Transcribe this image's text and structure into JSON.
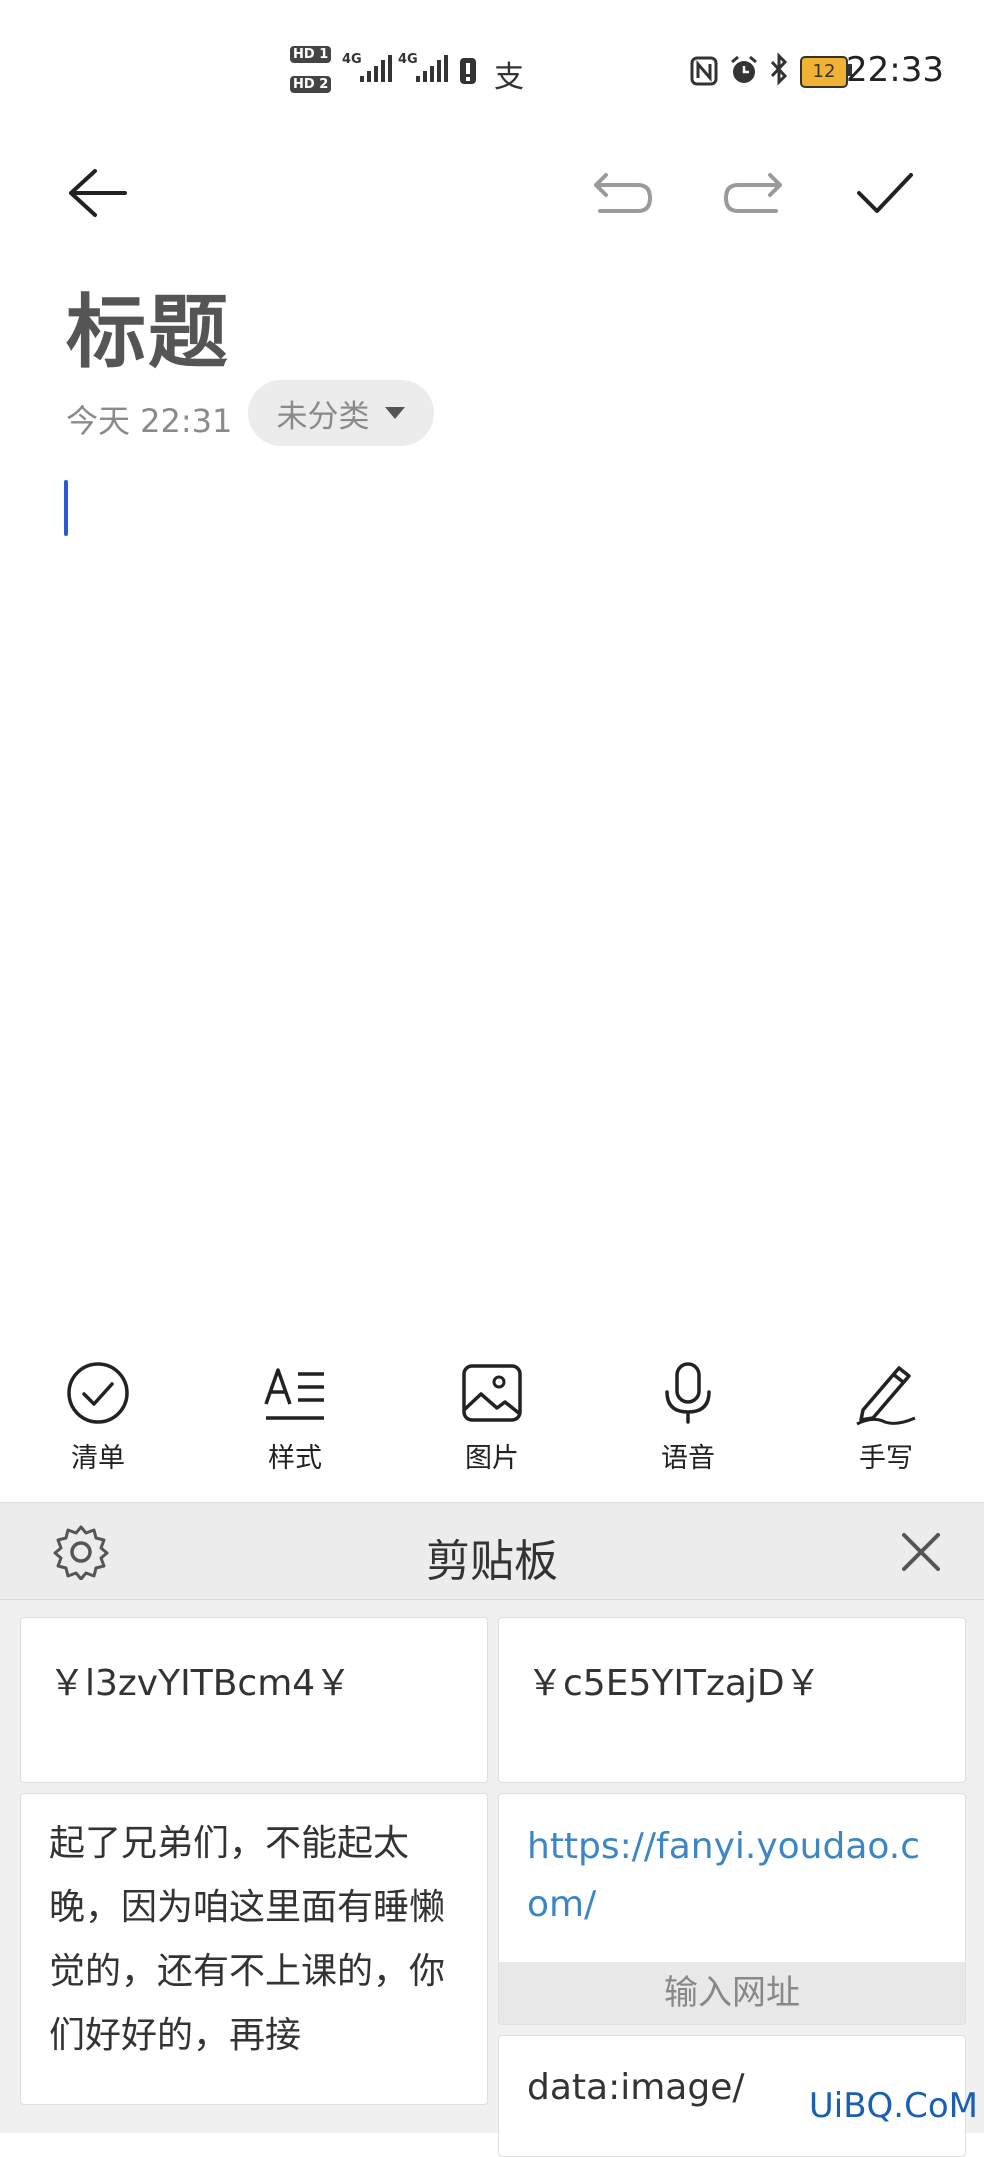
{
  "status_bar": {
    "hd1": "HD 1",
    "hd2": "HD 2",
    "net1": "4G",
    "net2": "4G",
    "battery": "12",
    "time": "22:33",
    "icons": [
      "signal-icon",
      "alert-icon",
      "alipay-icon",
      "nfc-icon",
      "alarm-icon",
      "bluetooth-icon",
      "battery-icon"
    ]
  },
  "toolbar": {
    "icons": [
      "back-arrow-icon",
      "undo-icon",
      "redo-icon",
      "check-icon"
    ]
  },
  "note": {
    "title": "标题",
    "date": "今天 22:31",
    "category": "未分类"
  },
  "tools": [
    {
      "label": "清单",
      "icon": "checklist-icon"
    },
    {
      "label": "样式",
      "icon": "text-style-icon"
    },
    {
      "label": "图片",
      "icon": "image-icon"
    },
    {
      "label": "语音",
      "icon": "microphone-icon"
    },
    {
      "label": "手写",
      "icon": "pen-icon"
    }
  ],
  "clipboard": {
    "title": "剪贴板",
    "items": [
      {
        "text": "￥l3zvYITBcm4￥"
      },
      {
        "text": "￥c5E5YITzajD￥"
      },
      {
        "text": "起了兄弟们，不能起太晚，因为咱这里面有睡懒觉的，还有不上课的，你们好好的，再接"
      },
      {
        "text": "https://fanyi.youdao.com/",
        "action": "输入网址"
      },
      {
        "text": "data:image/"
      }
    ]
  },
  "watermark": "UiBQ.CoM",
  "colors": {
    "accent": "#2a5bd7",
    "link": "#3d86c6"
  }
}
